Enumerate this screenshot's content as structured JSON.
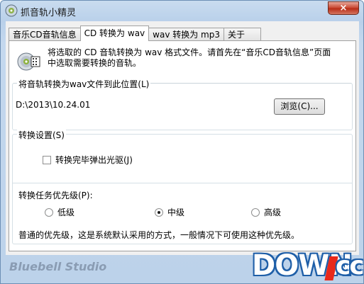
{
  "window": {
    "title": "抓音轨小精灵",
    "close_label": "×"
  },
  "tabs": [
    {
      "label": "音乐CD音轨信息",
      "active": false
    },
    {
      "label": "CD 转换为 wav",
      "active": true
    },
    {
      "label": "wav 转换为 mp3",
      "active": false
    },
    {
      "label": "关于",
      "active": false
    }
  ],
  "intro": {
    "line1": "将选取的 CD 音轨转换为 wav 格式文件。请首先在“音乐CD音轨信息”页面",
    "line2": "中选取需要转换的音轨。"
  },
  "path_group": {
    "title": "将音轨转换为wav文件到此位置(L)",
    "path_value": "D:\\2013\\10.24.01",
    "browse_label": "浏览(C)..."
  },
  "convert_group": {
    "title": "转换设置(S)",
    "eject_label": "转换完毕弹出光驱(J)",
    "eject_checked": false,
    "priority_label": "转换任务优先级(P):",
    "priority_options": [
      {
        "label": "低级",
        "selected": false
      },
      {
        "label": "中级",
        "selected": true
      },
      {
        "label": "高级",
        "selected": false
      }
    ],
    "priority_desc": "普通的优先级，这是系统默认采用的方式，一般情况下可使用这种优先级。"
  },
  "footer": {
    "studio": "Bluebell Studio",
    "watermark_main": "DOWN",
    "watermark_tld": "cc"
  },
  "colors": {
    "frame": "#bcd2ea",
    "close": "#c7432d",
    "watermark_blue": "#1f5fa8",
    "watermark_red": "#e8291b"
  }
}
